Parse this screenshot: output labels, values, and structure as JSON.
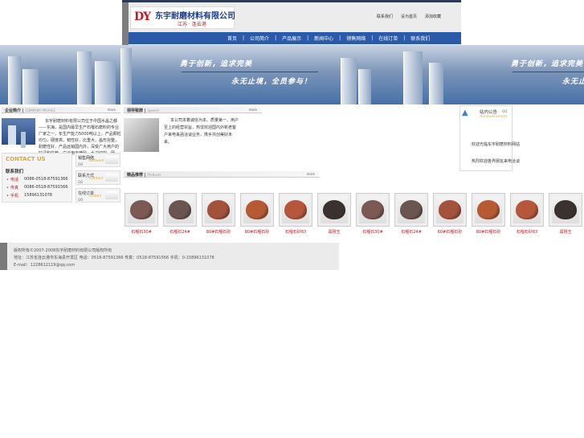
{
  "header": {
    "logo_mark": "DY",
    "company_name": "东宇耐磨材料有限公司",
    "slogan": "江苏 · 连云港",
    "top_links": [
      "联系我们",
      "设为首页",
      "添加收藏"
    ],
    "nav": [
      "首页",
      "公司简介",
      "产品展示",
      "新闻中心",
      "销售网络",
      "在线订单",
      "联系我们"
    ]
  },
  "banner": {
    "slogan_1": "勇于创新，追求完美",
    "slogan_2": "永无止境，全员参与！"
  },
  "about": {
    "title": "企业简介",
    "subtitle": "COMPANY PROFILE",
    "more": "more",
    "text": "东宇耐磨材料有限公司位于中国水晶之都——东海，是国内最早生产石榴石磨料的专业厂家之一，年生产能力5000吨以上，产品颗粒均匀，硬度高，韧性好，比重大，晶形完整，耐磨性好，产品远销国内外，深受广大用户的好评和信赖。广泛用于喷砂、水刀切割、研磨、抛光等……"
  },
  "contact": {
    "logo": "CONTACT US",
    "title": "联系我们",
    "rows": [
      {
        "label": "电话",
        "value": "0086-0518-87591366"
      },
      {
        "label": "传真",
        "value": "0086-0518-87591566"
      },
      {
        "label": "手机",
        "value": "15896131078"
      }
    ]
  },
  "side_tiles": [
    {
      "title": "销售网络",
      "en": "Network",
      "go": "GO"
    },
    {
      "title": "联系方式",
      "en": "Contact",
      "go": "GO"
    },
    {
      "title": "在线订单",
      "en": "Orders",
      "go": "GO"
    }
  ],
  "speech": {
    "title": "领导致辞",
    "subtitle": "Speech",
    "more": "more",
    "text": "本公司本着诚信为本、质量第一、用户至上的经营宗旨，热忱欢迎国内外新老客户来电来函洽谈业务，携手共创美好未来。"
  },
  "notice": {
    "title": "站内公告",
    "subtitle": "Announcement",
    "more": "GO",
    "items": [
      "欢迎光临东宇耐磨材料网站",
      "热烈欢迎各界朋友来电洽谈"
    ]
  },
  "products": {
    "title": "精品推荐",
    "subtitle": "Products",
    "more": "more",
    "items": [
      {
        "label": "石榴石30#",
        "color": "#7a5a52"
      },
      {
        "label": "石榴石24#",
        "color": "#6b5550"
      },
      {
        "label": "80#石榴石砂",
        "color": "#a3533b"
      },
      {
        "label": "80#石榴石砂",
        "color": "#b55a33"
      },
      {
        "label": "石榴石砂83",
        "color": "#b4573a"
      },
      {
        "label": "黑刚玉",
        "color": "#3a3230"
      },
      {
        "label": "石榴石30#",
        "color": "#7a5a52"
      },
      {
        "label": "石榴石24#",
        "color": "#6b5550"
      },
      {
        "label": "60#石榴石砂",
        "color": "#a3533b"
      },
      {
        "label": "80#石榴石砂",
        "color": "#b55a33"
      },
      {
        "label": "石榴石砂83",
        "color": "#b4573a"
      },
      {
        "label": "黑刚玉",
        "color": "#3a3230"
      }
    ]
  },
  "footer": {
    "line1": "版权所有©2007-2008东宇耐磨材料有限公司版权所有",
    "line2": "地址：江苏省连云港市东海县开发区 电话：0518-87591366 传真：0518-87591566 手机：0-15896131078",
    "line3": "E-mail：1228612119@qq.com"
  }
}
